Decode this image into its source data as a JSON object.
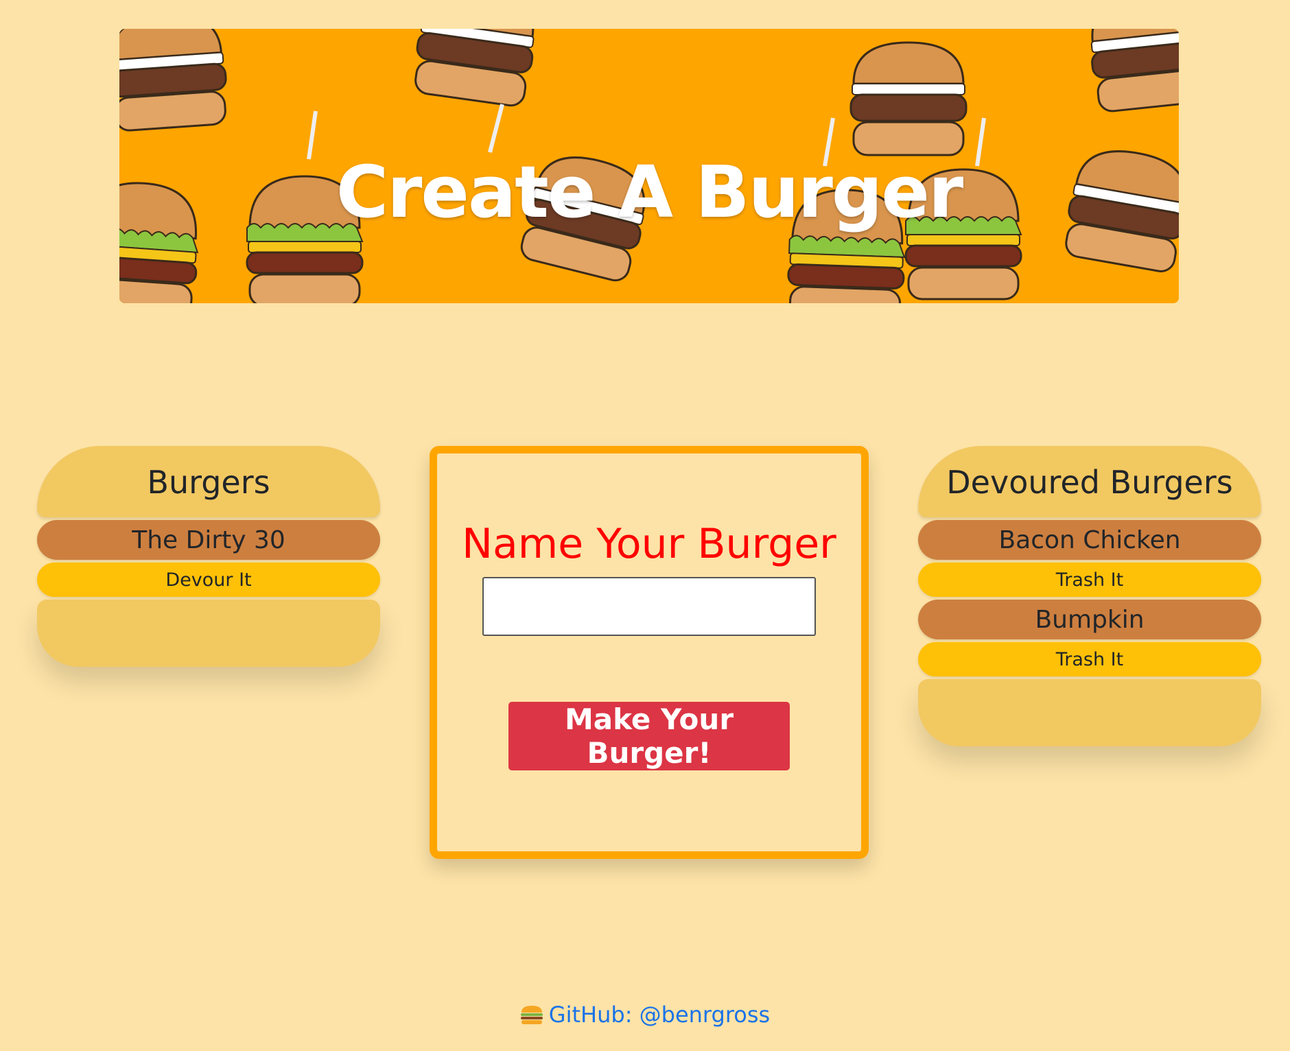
{
  "banner": {
    "title": "Create A Burger",
    "background_color": "#ffa500"
  },
  "burgers_panel": {
    "title": "Burgers",
    "items": [
      {
        "name": "The Dirty 30",
        "action_label": "Devour It"
      }
    ]
  },
  "form": {
    "heading": "Name Your Burger",
    "input_value": "",
    "input_placeholder": "",
    "submit_label": "Make Your Burger!"
  },
  "devoured_panel": {
    "title": "Devoured Burgers",
    "items": [
      {
        "name": "Bacon Chicken",
        "action_label": "Trash It"
      },
      {
        "name": "Bumpkin",
        "action_label": "Trash It"
      }
    ]
  },
  "footer": {
    "icon": "burger-icon",
    "link_label": "GitHub: @benrgross"
  },
  "colors": {
    "page_background": "#fde3a7",
    "bun": "#f2c861",
    "patty": "#cd7f3f",
    "cheese": "#ffc107",
    "accent_border": "#ffa500",
    "heading_red": "#ff0000",
    "button_red": "#dc3545",
    "link_blue": "#1a73e8"
  }
}
